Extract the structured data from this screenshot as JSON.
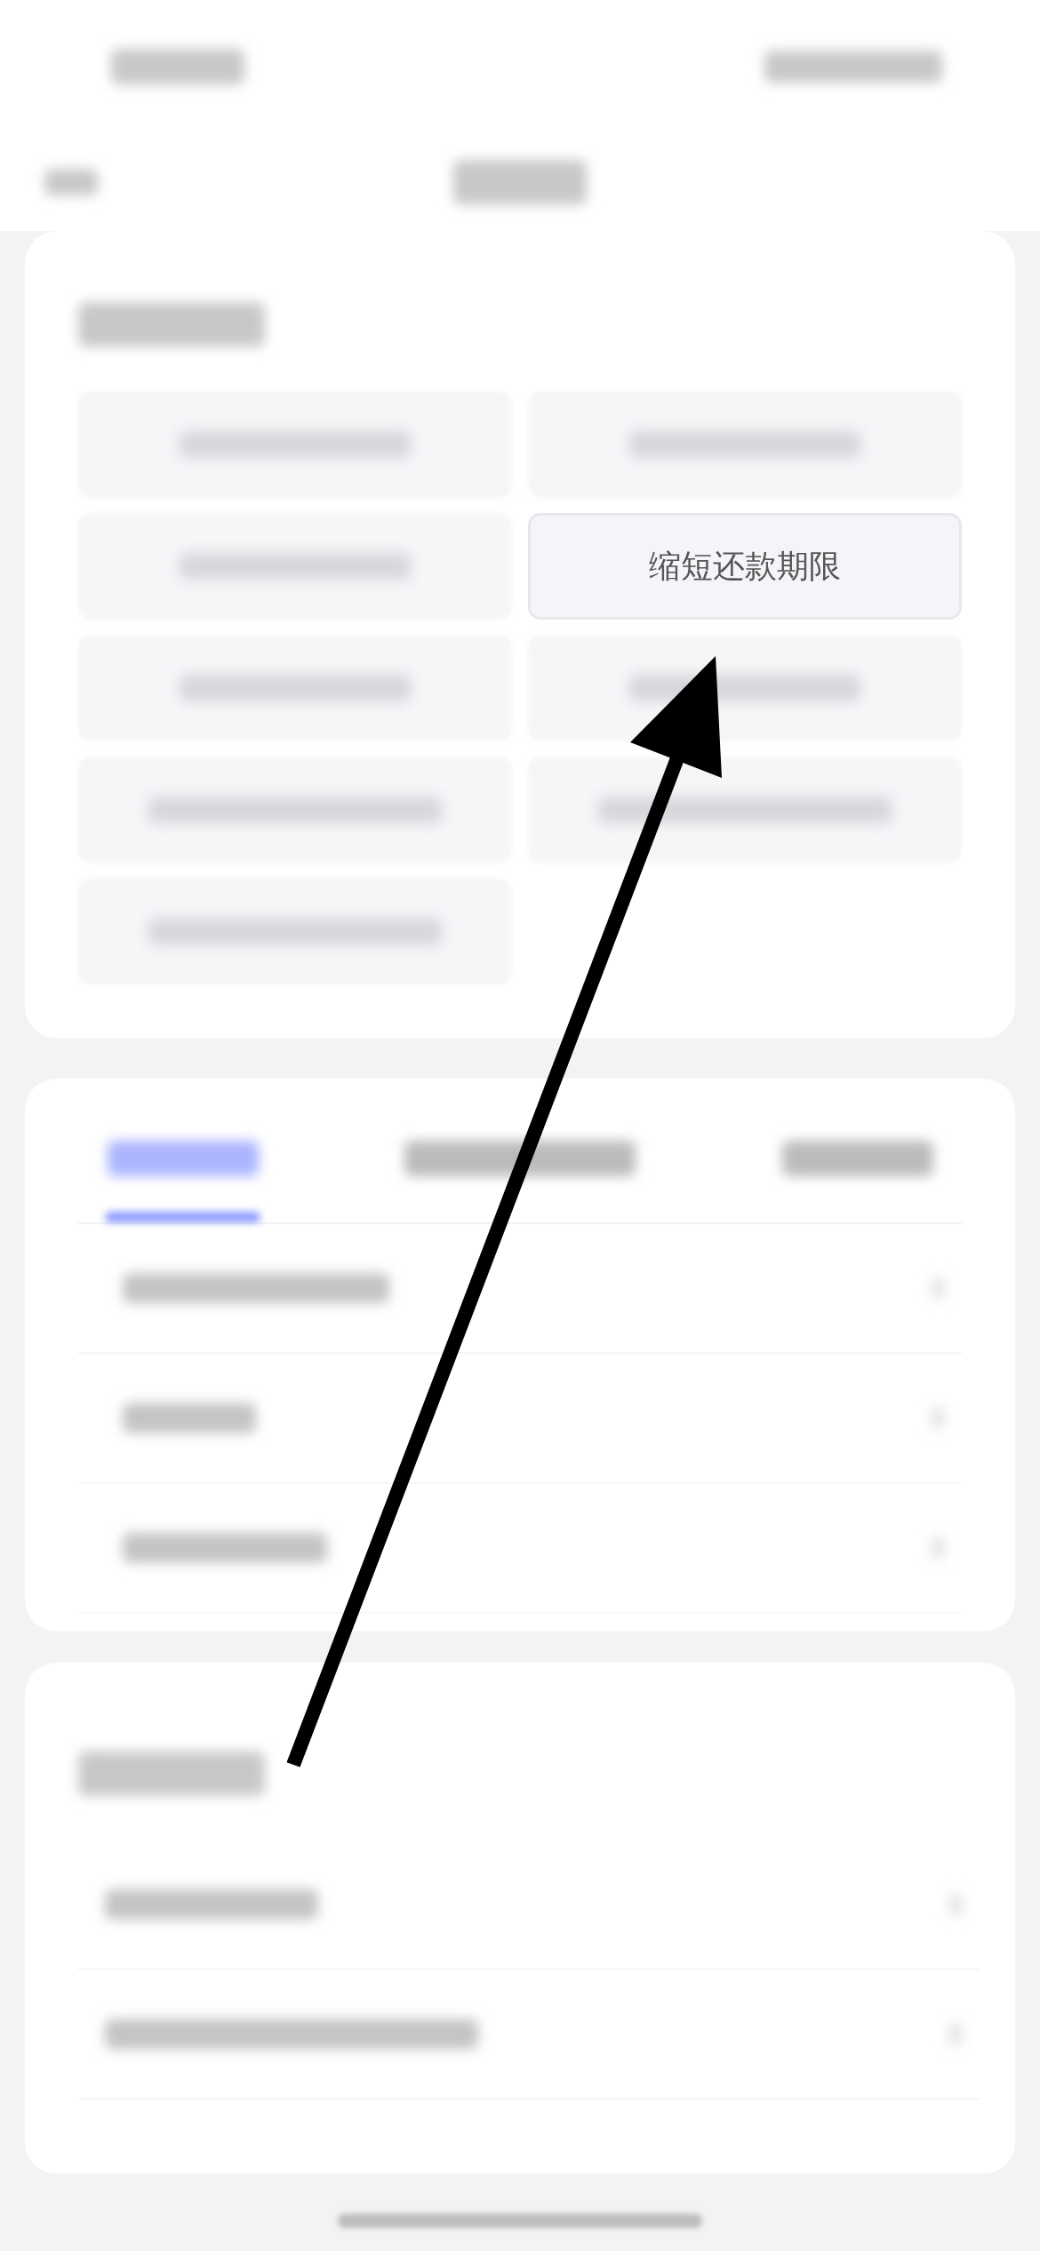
{
  "loan_services": {
    "buttons": [
      {
        "kind": "blurred"
      },
      {
        "kind": "blurred"
      },
      {
        "kind": "blurred"
      },
      {
        "kind": "label",
        "label": "缩短还款期限"
      },
      {
        "kind": "blurred"
      },
      {
        "kind": "blurred"
      },
      {
        "kind": "blurred"
      },
      {
        "kind": "blurred"
      },
      {
        "kind": "blurred"
      }
    ]
  },
  "tabs": [
    {
      "selected": true
    },
    {
      "selected": false
    },
    {
      "selected": false
    }
  ],
  "annotation": {
    "kind": "arrow"
  }
}
